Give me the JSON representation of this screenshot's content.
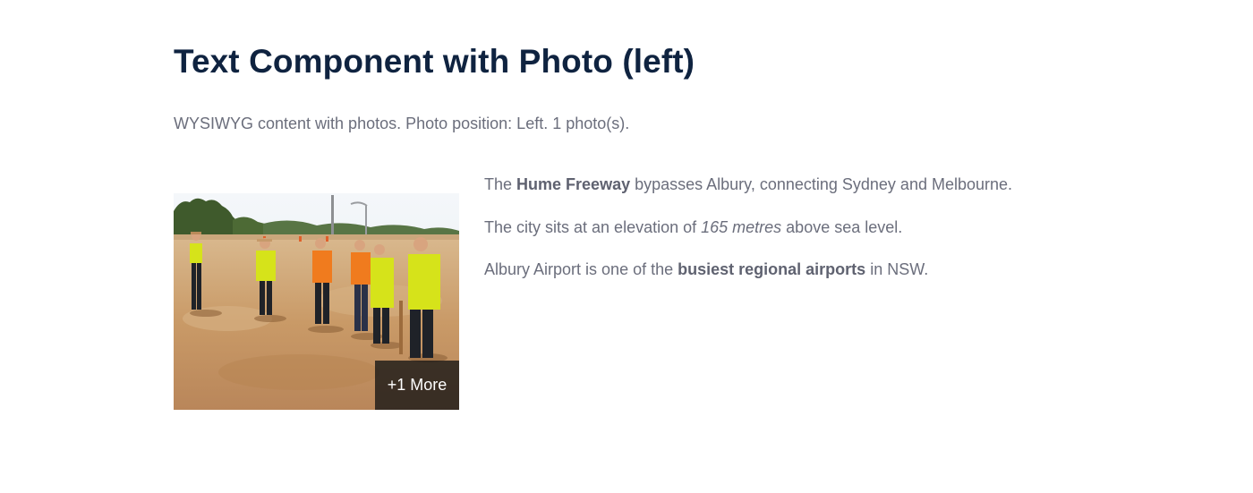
{
  "heading": "Text Component with Photo (left)",
  "intro": "WYSIWYG content with photos. Photo position: Left. 1 photo(s).",
  "photo": {
    "more_label": "+1 More"
  },
  "paragraphs": [
    {
      "pre": "The ",
      "bold": "Hume Freeway",
      "post": " bypasses Albury, connecting Sydney and Melbourne."
    },
    {
      "pre": "The city sits at an elevation of ",
      "italic": "165 metres",
      "post": " above sea level."
    },
    {
      "pre": "Albury Airport is one of the ",
      "bold": "busiest regional airports",
      "post": " in NSW."
    }
  ],
  "colors": {
    "heading": "#0f2340",
    "body_text": "#6b6e7c",
    "overlay_bg": "#141414"
  }
}
